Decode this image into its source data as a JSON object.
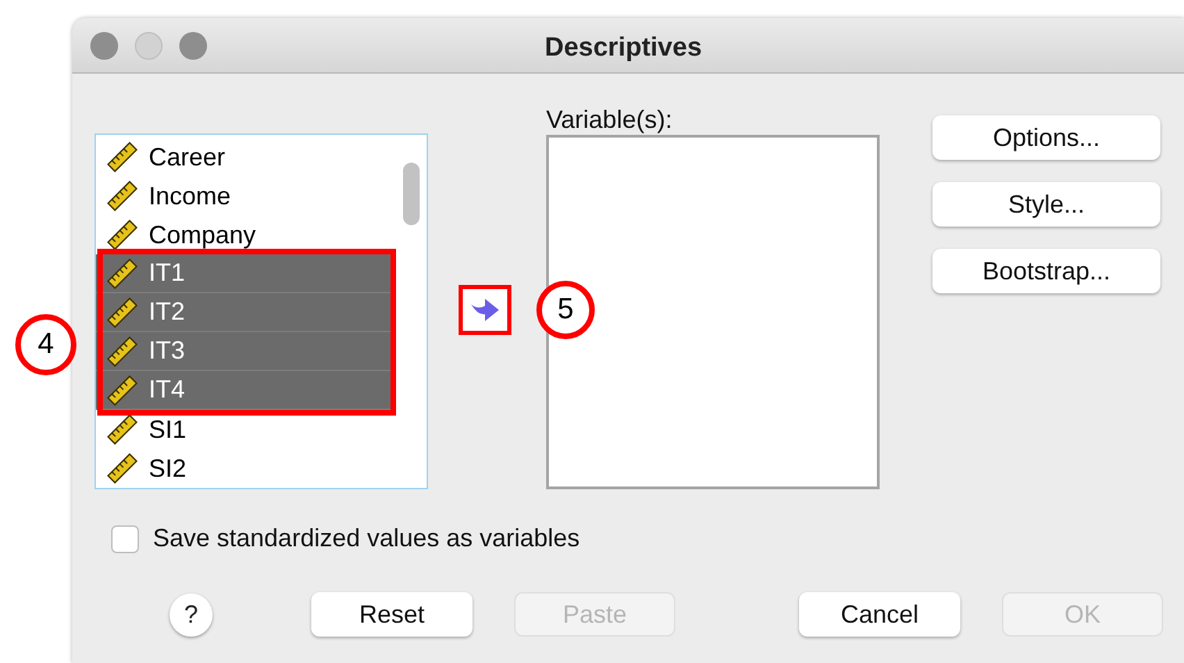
{
  "window": {
    "title": "Descriptives"
  },
  "source_list": {
    "items": [
      {
        "label": "Career",
        "selected": false
      },
      {
        "label": "Income",
        "selected": false
      },
      {
        "label": "Company",
        "selected": false
      },
      {
        "label": "IT1",
        "selected": true
      },
      {
        "label": "IT2",
        "selected": true
      },
      {
        "label": "IT3",
        "selected": true
      },
      {
        "label": "IT4",
        "selected": true
      },
      {
        "label": "SI1",
        "selected": false
      },
      {
        "label": "SI2",
        "selected": false
      }
    ]
  },
  "variables": {
    "label": "Variable(s):"
  },
  "side_buttons": [
    "Options...",
    "Style...",
    "Bootstrap..."
  ],
  "checkbox": {
    "label": "Save standardized values as variables",
    "checked": false
  },
  "help_button": "?",
  "bottom_buttons": [
    {
      "label": "Reset",
      "disabled": false
    },
    {
      "label": "Paste",
      "disabled": true
    },
    {
      "label": "Cancel",
      "disabled": false
    },
    {
      "label": "OK",
      "disabled": true
    }
  ],
  "callouts": [
    "4",
    "5"
  ]
}
